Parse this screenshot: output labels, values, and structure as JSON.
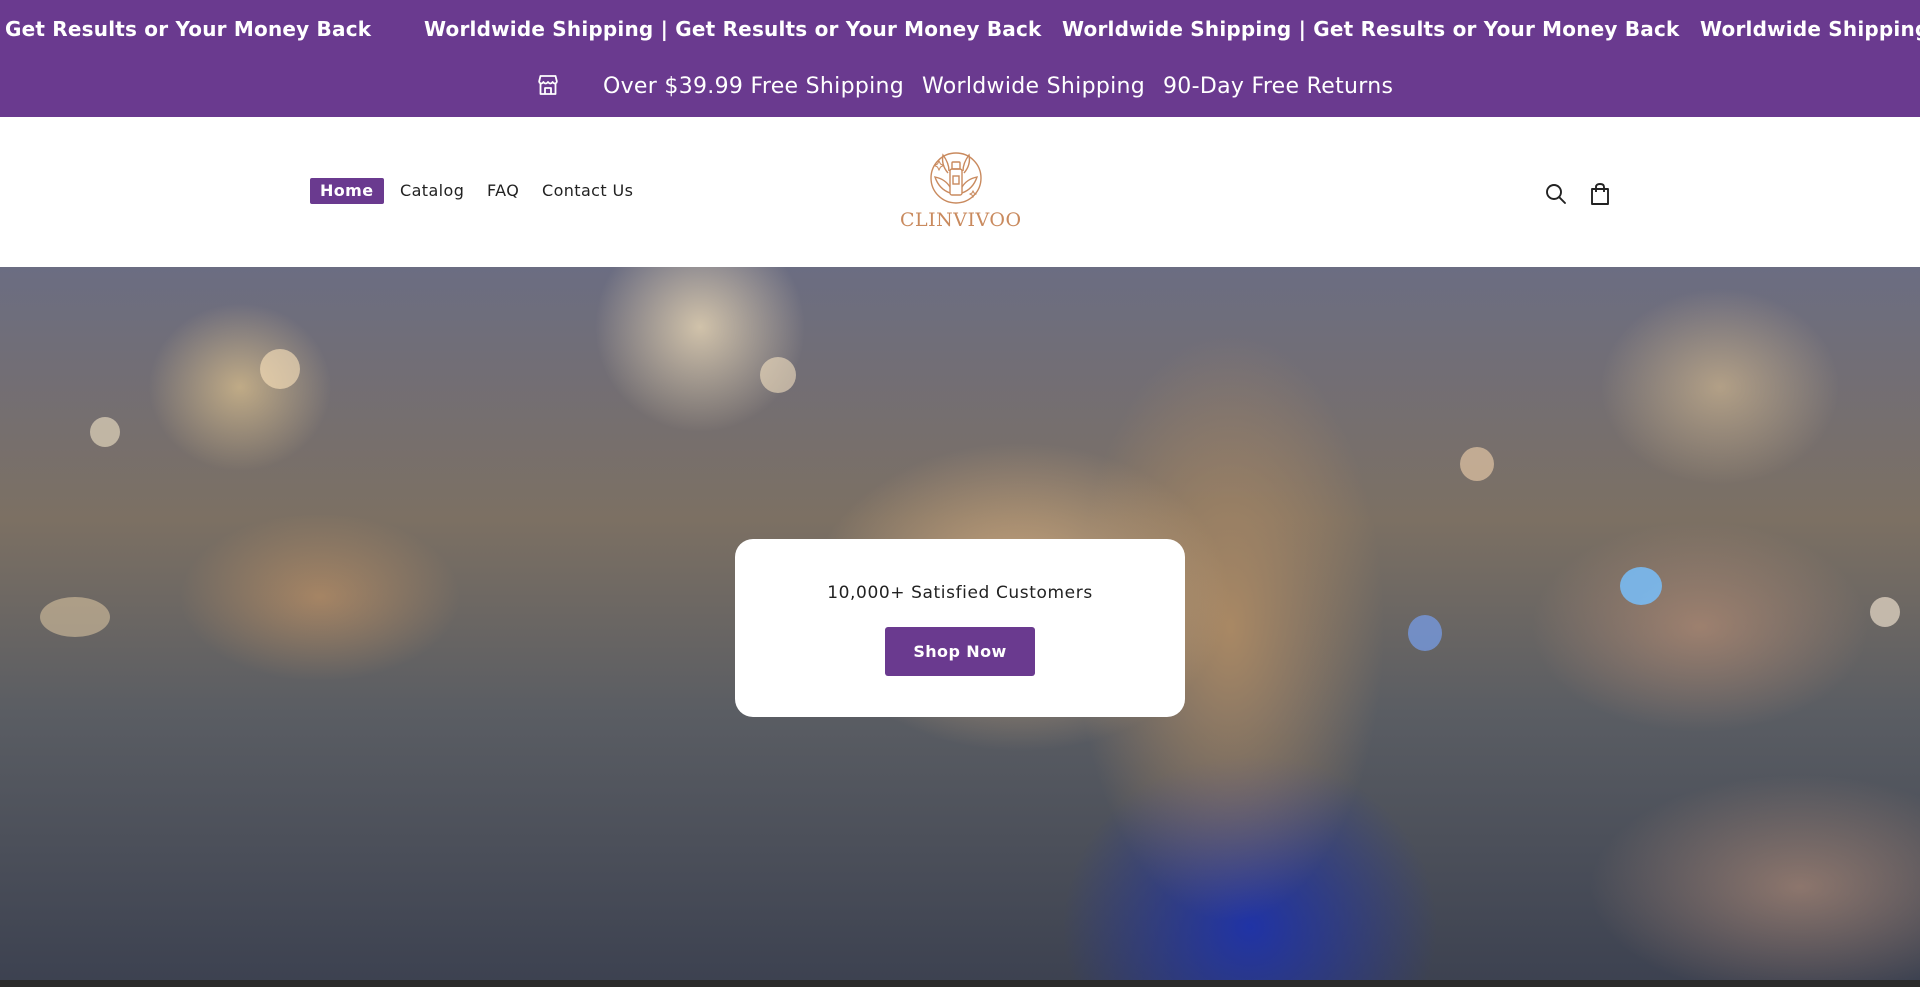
{
  "announcement": {
    "items": [
      "Get Results or Your Money Back",
      "Worldwide Shipping | Get Results or Your Money Back",
      "Worldwide Shipping | Get Results or Your Money Back",
      "Worldwide Shipping |"
    ]
  },
  "perks": {
    "icon": "store-icon",
    "items": [
      "Over $39.99 Free Shipping",
      "Worldwide Shipping",
      "90-Day Free Returns"
    ]
  },
  "nav": {
    "items": [
      {
        "label": "Home",
        "active": true
      },
      {
        "label": "Catalog",
        "active": false
      },
      {
        "label": "FAQ",
        "active": false
      },
      {
        "label": "Contact Us",
        "active": false
      }
    ]
  },
  "logo": {
    "text": "CLINVIVOO",
    "icon": "bottle-leaves-logo"
  },
  "header_icons": {
    "search": "search-icon",
    "cart": "shopping-bag-icon"
  },
  "hero": {
    "card_text": "10,000+ Satisfied Customers",
    "button_label": "Shop Now"
  },
  "colors": {
    "brand_purple": "#6a3a8f",
    "logo_copper": "#c98a5e",
    "white": "#ffffff"
  }
}
